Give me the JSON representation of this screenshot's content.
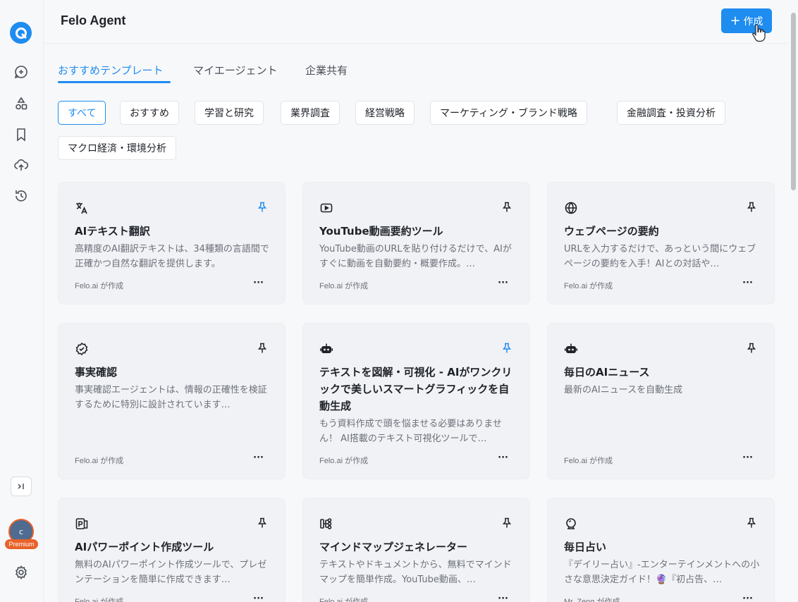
{
  "header": {
    "title": "Felo Agent",
    "create_label": "作成"
  },
  "tabs": [
    {
      "label": "おすすめテンプレート"
    },
    {
      "label": "マイエージェント"
    },
    {
      "label": "企業共有"
    }
  ],
  "chips": [
    {
      "label": "すべて"
    },
    {
      "label": "おすすめ"
    },
    {
      "label": "学習と研究"
    },
    {
      "label": "業界調査"
    },
    {
      "label": "経営戦略"
    },
    {
      "label": "マーケティング・ブランド戦略"
    },
    {
      "label": "金融調査・投資分析"
    },
    {
      "label": "マクロ経済・環境分析"
    }
  ],
  "user": {
    "initial": "c",
    "badge": "Premium"
  },
  "colors": {
    "accent": "#1f8cf0",
    "premium": "#e8622a"
  },
  "cards": [
    {
      "icon": "translate-icon",
      "pinned": true,
      "title": "AIテキスト翻訳",
      "description": "高精度のAI翻訳テキストは、34種類の言語間で正確かつ自然な翻訳を提供します。",
      "author": "Felo.ai が作成"
    },
    {
      "icon": "youtube-icon",
      "pinned": false,
      "title": "YouTube動画要約ツール",
      "description": "YouTube動画のURLを貼り付けるだけで、AIがすぐに動画を自動要約・概要作成。…",
      "author": "Felo.ai が作成"
    },
    {
      "icon": "globe-icon",
      "pinned": false,
      "title": "ウェブページの要約",
      "description": "URLを入力するだけで、あっという間にウェブページの要約を入手！AIとの対話や…",
      "author": "Felo.ai が作成"
    },
    {
      "icon": "verified-badge-icon",
      "pinned": false,
      "title": "事実確認",
      "description": "事実確認エージェントは、情報の正確性を検証するために特別に設計されています…",
      "author": "Felo.ai が作成"
    },
    {
      "icon": "robot-icon",
      "pinned": true,
      "title": "テキストを図解・可視化 - AIがワンクリックで美しいスマートグラフィックを自動生成",
      "description": "もう資料作成で頭を悩ませる必要はありません！ AI搭載のテキスト可視化ツールで…",
      "author": "Felo.ai が作成"
    },
    {
      "icon": "robot-icon",
      "pinned": false,
      "title": "毎日のAIニュース",
      "description": "最新のAIニュースを自動生成",
      "author": "Felo.ai が作成"
    },
    {
      "icon": "powerpoint-icon",
      "pinned": false,
      "title": "AIパワーポイント作成ツール",
      "description": "無料のAIパワーポイント作成ツールで、プレゼンテーションを簡単に作成できます…",
      "author": "Felo.ai が作成"
    },
    {
      "icon": "mindmap-icon",
      "pinned": false,
      "title": "マインドマップジェネレーター",
      "description": "テキストやドキュメントから、無料でマインドマップを簡単作成。YouTube動画、…",
      "author": "Felo.ai が作成"
    },
    {
      "icon": "fortune-icon",
      "pinned": false,
      "title": "毎日占い",
      "description": "『デイリー占い』-エンターテインメントへの小さな意思決定ガイド！🔮『初占告、…",
      "author": "Mr. Zeng が作成"
    }
  ]
}
